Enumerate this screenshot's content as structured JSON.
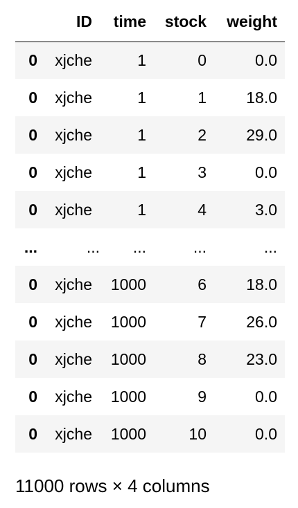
{
  "table": {
    "columns": [
      "ID",
      "time",
      "stock",
      "weight"
    ],
    "rows": [
      {
        "index": "0",
        "ID": "xjche",
        "time": "1",
        "stock": "0",
        "weight": "0.0"
      },
      {
        "index": "0",
        "ID": "xjche",
        "time": "1",
        "stock": "1",
        "weight": "18.0"
      },
      {
        "index": "0",
        "ID": "xjche",
        "time": "1",
        "stock": "2",
        "weight": "29.0"
      },
      {
        "index": "0",
        "ID": "xjche",
        "time": "1",
        "stock": "3",
        "weight": "0.0"
      },
      {
        "index": "0",
        "ID": "xjche",
        "time": "1",
        "stock": "4",
        "weight": "3.0"
      },
      {
        "index": "...",
        "ID": "...",
        "time": "...",
        "stock": "...",
        "weight": "..."
      },
      {
        "index": "0",
        "ID": "xjche",
        "time": "1000",
        "stock": "6",
        "weight": "18.0"
      },
      {
        "index": "0",
        "ID": "xjche",
        "time": "1000",
        "stock": "7",
        "weight": "26.0"
      },
      {
        "index": "0",
        "ID": "xjche",
        "time": "1000",
        "stock": "8",
        "weight": "23.0"
      },
      {
        "index": "0",
        "ID": "xjche",
        "time": "1000",
        "stock": "9",
        "weight": "0.0"
      },
      {
        "index": "0",
        "ID": "xjche",
        "time": "1000",
        "stock": "10",
        "weight": "0.0"
      }
    ]
  },
  "footer": {
    "shape_text": "11000 rows × 4 columns"
  },
  "colors": {
    "stripe": "#f5f5f5",
    "header_rule": "#000000",
    "background": "#ffffff"
  }
}
